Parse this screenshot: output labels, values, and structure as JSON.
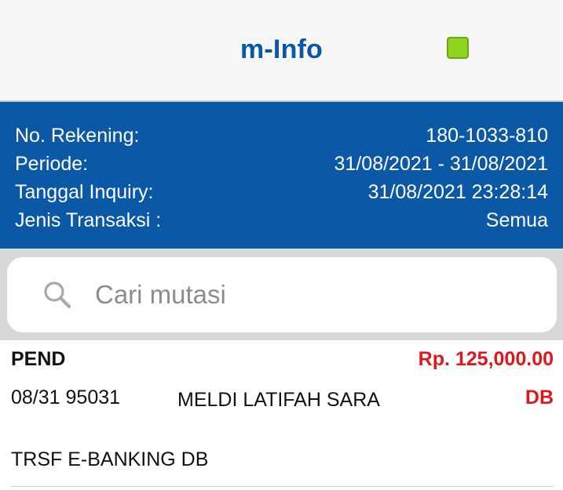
{
  "header": {
    "title": "m-Info",
    "status_color": "#8fd41c",
    "status_icon": "green-status-square"
  },
  "account_info": {
    "rows": [
      {
        "label": "No. Rekening:",
        "value": "180-1033-810"
      },
      {
        "label": "Periode:",
        "value": "31/08/2021 - 31/08/2021"
      },
      {
        "label": "Tanggal Inquiry:",
        "value": "31/08/2021 23:28:14"
      },
      {
        "label": "Jenis Transaksi :",
        "value": "Semua"
      }
    ]
  },
  "search": {
    "placeholder": "Cari mutasi",
    "value": "",
    "icon": "search-icon"
  },
  "transactions": [
    {
      "status": "PEND",
      "amount": "Rp. 125,000.00",
      "code": "08/31 95031",
      "name": "MELDI LATIFAH SARA",
      "type": "DB",
      "description": "TRSF E-BANKING DB"
    }
  ],
  "colors": {
    "brand_blue": "#0b59a6",
    "title_blue": "#0b57a4",
    "amount_red": "#e0161c"
  }
}
